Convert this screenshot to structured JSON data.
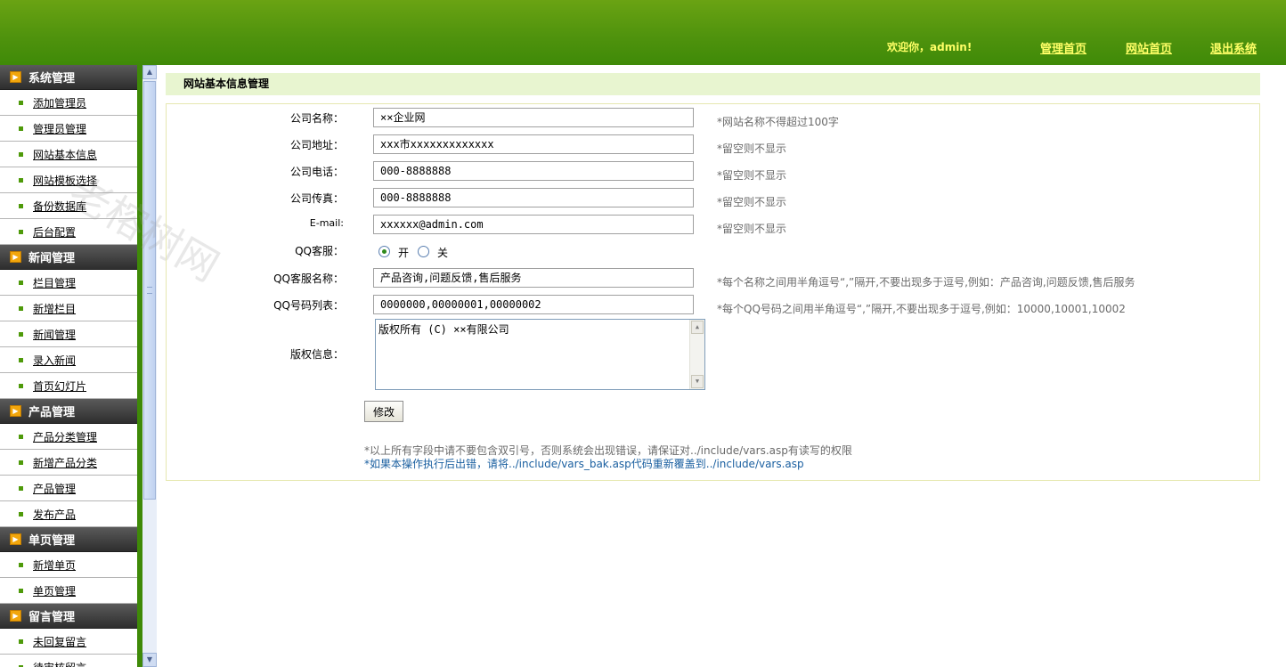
{
  "header": {
    "welcome": "欢迎你，admin!",
    "links": [
      "管理首页",
      "网站首页",
      "退出系统"
    ]
  },
  "sidebar": {
    "sections": [
      {
        "title": "系统管理",
        "items": [
          "添加管理员",
          "管理员管理",
          "网站基本信息",
          "网站模板选择",
          "备份数据库",
          "后台配置"
        ]
      },
      {
        "title": "新闻管理",
        "items": [
          "栏目管理",
          "新增栏目",
          "新闻管理",
          "录入新闻",
          "首页幻灯片"
        ]
      },
      {
        "title": "产品管理",
        "items": [
          "产品分类管理",
          "新增产品分类",
          "产品管理",
          "发布产品"
        ]
      },
      {
        "title": "单页管理",
        "items": [
          "新增单页",
          "单页管理"
        ]
      },
      {
        "title": "留言管理",
        "items": [
          "未回复留言",
          "待审核留言"
        ]
      }
    ]
  },
  "main": {
    "title": "网站基本信息管理",
    "fields": [
      {
        "label": "公司名称：",
        "value": "××企业网",
        "hint": "*网站名称不得超过100字"
      },
      {
        "label": "公司地址：",
        "value": "xxx市xxxxxxxxxxxxx",
        "hint": "*留空则不显示"
      },
      {
        "label": "公司电话：",
        "value": "000-8888888",
        "hint": "*留空则不显示"
      },
      {
        "label": "公司传真：",
        "value": "000-8888888",
        "hint": "*留空则不显示"
      },
      {
        "label": "E-mail:",
        "value": "xxxxxx@admin.com",
        "hint": "*留空则不显示"
      }
    ],
    "qq": {
      "label": "QQ客服：",
      "on": "开",
      "off": "关",
      "selected": "开"
    },
    "qq_names": {
      "label": "QQ客服名称：",
      "value": "产品咨询,问题反馈,售后服务",
      "hint": "*每个名称之间用半角逗号“,”隔开,不要出现多于逗号,例如：产品咨询,问题反馈,售后服务"
    },
    "qq_numbers": {
      "label": "QQ号码列表：",
      "value": "0000000,00000001,00000002",
      "hint": "*每个QQ号码之间用半角逗号“,”隔开,不要出现多于逗号,例如：10000,10001,10002"
    },
    "copyright": {
      "label": "版权信息：",
      "value": "版权所有 (C) ××有限公司"
    },
    "submit": "修改",
    "note1": "*以上所有字段中请不要包含双引号，否则系统会出现错误，请保证对../include/vars.asp有读写的权限",
    "note2": "*如果本操作执行后出错，请将../include/vars_bak.asp代码重新覆盖到../include/vars.asp"
  },
  "watermark": "老榕树网"
}
